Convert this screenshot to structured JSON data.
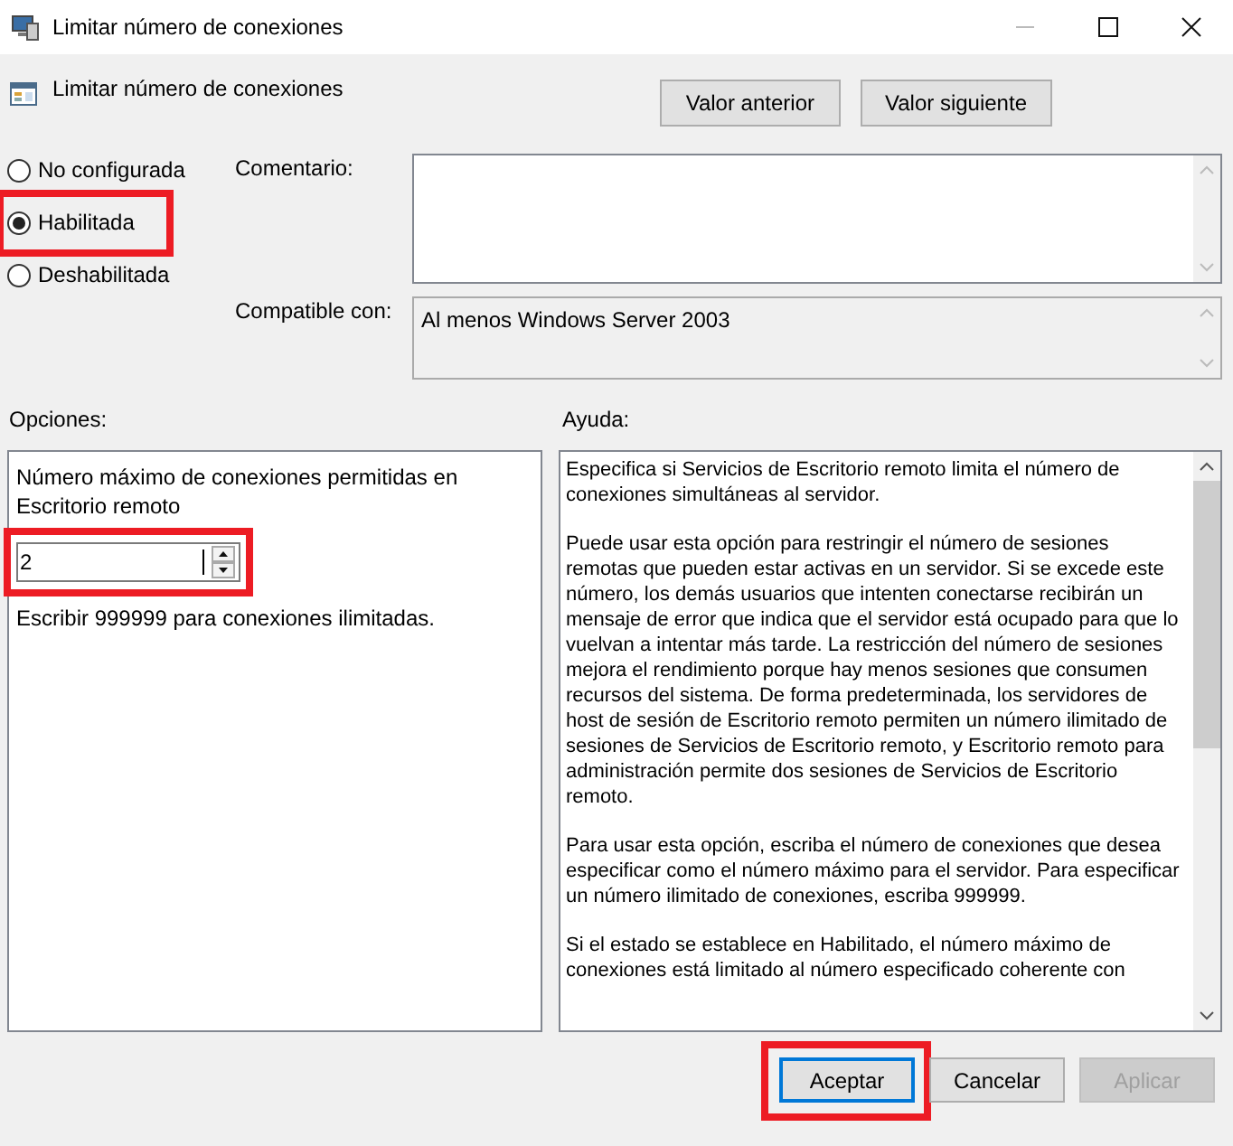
{
  "window": {
    "title": "Limitar número de conexiones"
  },
  "policy": {
    "name": "Limitar número de conexiones"
  },
  "nav_buttons": [
    "Valor anterior",
    "Valor siguiente"
  ],
  "states": [
    {
      "label": "No configurada",
      "selected": false,
      "highlighted": false
    },
    {
      "label": "Habilitada",
      "selected": true,
      "highlighted": true
    },
    {
      "label": "Deshabilitada",
      "selected": false,
      "highlighted": false
    }
  ],
  "comment": {
    "label": "Comentario:"
  },
  "compatible": {
    "label": "Compatible con:",
    "value": "Al menos Windows Server 2003"
  },
  "options": {
    "label": "Opciones:",
    "field_label": "Número máximo de conexiones permitidas en Escritorio remoto",
    "value": "2",
    "highlighted": true,
    "hint": "Escribir 999999 para conexiones ilimitadas."
  },
  "help": {
    "label": "Ayuda:",
    "paragraphs": [
      "Especifica si Servicios de Escritorio remoto limita el número de conexiones simultáneas al servidor.",
      "Puede usar esta opción para restringir el número de sesiones remotas que pueden estar activas en un servidor. Si se excede este número, los demás usuarios que intenten conectarse recibirán un mensaje de error que indica que el servidor está ocupado para que lo vuelvan a intentar más tarde. La restricción del número de sesiones mejora el rendimiento porque hay menos sesiones que consumen recursos del sistema. De forma predeterminada, los servidores de host de sesión de Escritorio remoto permiten un número ilimitado de sesiones de Servicios de Escritorio remoto, y Escritorio remoto para administración permite dos sesiones de Servicios de Escritorio remoto.",
      "Para usar esta opción, escriba el número de conexiones que desea especificar como el número máximo para el servidor. Para especificar un número ilimitado de conexiones, escriba 999999.",
      "Si el estado se establece en Habilitado, el número máximo de conexiones está limitado al número especificado coherente con"
    ]
  },
  "buttons": [
    {
      "label": "Aceptar",
      "default": true,
      "disabled": false,
      "highlighted": true
    },
    {
      "label": "Cancelar",
      "default": false,
      "disabled": false,
      "highlighted": false
    },
    {
      "label": "Aplicar",
      "default": false,
      "disabled": true,
      "highlighted": false
    }
  ]
}
